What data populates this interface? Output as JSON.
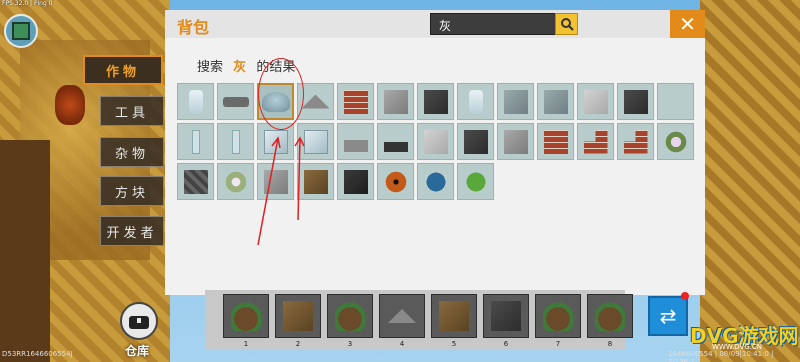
{
  "hud": {
    "fps": "FPS 32.0 | Ping 0"
  },
  "categories": [
    {
      "label": "作物",
      "active": true
    },
    {
      "label": "工具",
      "active": false
    },
    {
      "label": "杂物",
      "active": false
    },
    {
      "label": "方块",
      "active": false
    },
    {
      "label": "开发者",
      "active": false
    }
  ],
  "panel": {
    "title": "背包",
    "search_value": "灰",
    "close_label": "✕",
    "result_prefix": "搜索",
    "result_keyword": "灰",
    "result_suffix": "的结果"
  },
  "items": [
    {
      "type": "jar"
    },
    {
      "type": "cannon"
    },
    {
      "type": "mushroom",
      "selected": true
    },
    {
      "type": "pile"
    },
    {
      "type": "brick"
    },
    {
      "type": "grey"
    },
    {
      "type": "dark"
    },
    {
      "type": "jar"
    },
    {
      "type": "glassframe"
    },
    {
      "type": "glassframe"
    },
    {
      "type": "light"
    },
    {
      "type": "dark"
    },
    {
      "type": "empty"
    },
    {
      "type": "pane"
    },
    {
      "type": "pane"
    },
    {
      "type": "glass"
    },
    {
      "type": "glass"
    },
    {
      "type": "slab"
    },
    {
      "type": "darkslab"
    },
    {
      "type": "light"
    },
    {
      "type": "dark"
    },
    {
      "type": "grey"
    },
    {
      "type": "brick"
    },
    {
      "type": "brickstairs"
    },
    {
      "type": "brickstairs"
    },
    {
      "type": "plant"
    },
    {
      "type": "cobble"
    },
    {
      "type": "flower"
    },
    {
      "type": "grey"
    },
    {
      "type": "dirt"
    },
    {
      "type": "obsid"
    },
    {
      "type": "ladybug"
    },
    {
      "type": "beetle"
    },
    {
      "type": "melon"
    }
  ],
  "hotbar": {
    "slots": [
      {
        "num": "1",
        "type": "bag"
      },
      {
        "num": "2",
        "type": "dirt"
      },
      {
        "num": "3",
        "type": "bag"
      },
      {
        "num": "4",
        "type": "pile"
      },
      {
        "num": "5",
        "type": "dirt"
      },
      {
        "num": "6",
        "type": "dark"
      },
      {
        "num": "7",
        "type": "bag"
      },
      {
        "num": "8",
        "type": "bag"
      }
    ]
  },
  "store": {
    "label": "仓库"
  },
  "footer": {
    "left": "D53RR1646606554J",
    "right": "1646606554 | 08/09|10:41:0 | 7|136:1"
  },
  "watermark": {
    "title": "DVG游戏网",
    "sub": "WWW.DVG.CN"
  }
}
